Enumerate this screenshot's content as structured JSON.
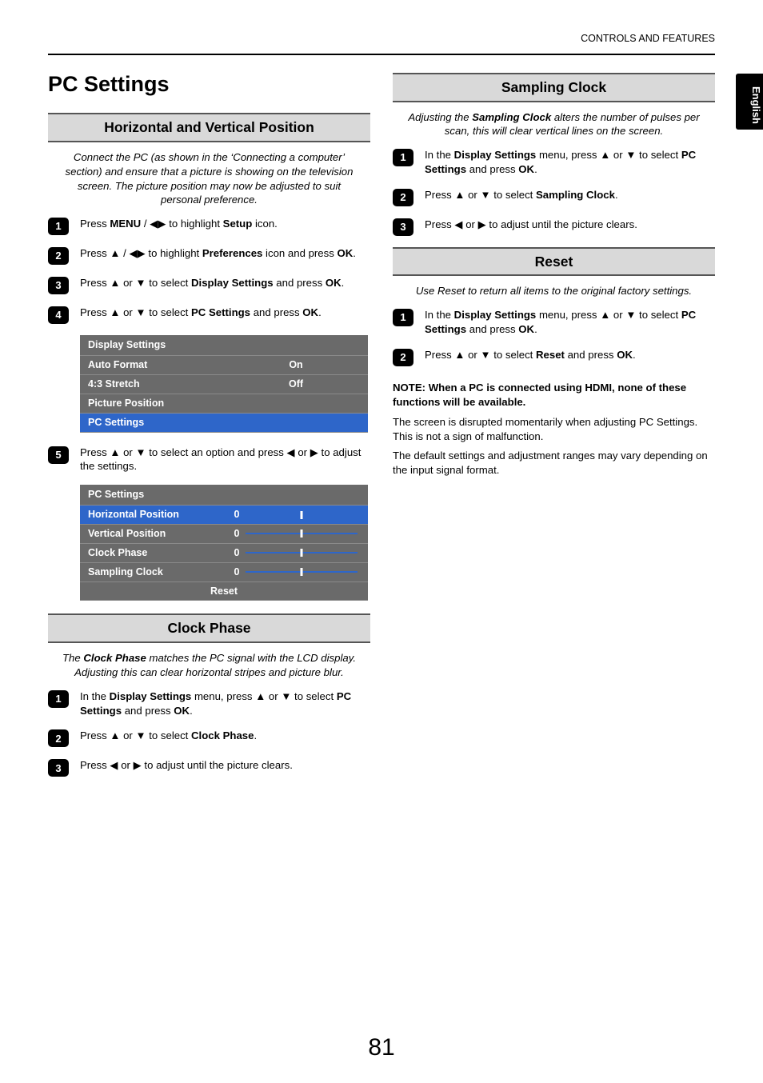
{
  "header": {
    "breadcrumb": "CONTROLS AND FEATURES",
    "lang_tab": "English"
  },
  "glyphs": {
    "up": "▲",
    "down": "▼",
    "left": "◀",
    "right": "▶"
  },
  "page_number": "81",
  "left": {
    "title": "PC Settings",
    "hv_band": "Horizontal and Vertical Position",
    "hv_intro": "Connect the PC (as shown in the ‘Connecting a computer’ section) and ensure that a picture is showing on the television screen. The picture position may now be adjusted to suit personal preference.",
    "step1_a": "Press ",
    "step1_menu": "MENU",
    "step1_b": " / ",
    "step1_c": " to highlight ",
    "step1_setup": "Setup",
    "step1_d": " icon.",
    "step2_a": "Press ",
    "step2_b": " / ",
    "step2_c": " to highlight ",
    "step2_prefs": "Preferences",
    "step2_d": " icon and press ",
    "step2_ok": "OK",
    "step2_e": ".",
    "step3_a": "Press ",
    "step3_b": " or ",
    "step3_c": " to select ",
    "step3_ds": "Display Settings",
    "step3_d": " and press ",
    "step3_ok": "OK",
    "step3_e": ".",
    "step4_a": "Press ",
    "step4_b": " or ",
    "step4_c": " to select ",
    "step4_pcs": "PC Settings",
    "step4_d": " and press ",
    "step4_ok": "OK",
    "step4_e": ".",
    "table1": {
      "title": "Display Settings",
      "rows": [
        {
          "label": "Auto Format",
          "value": "On"
        },
        {
          "label": "4:3 Stretch",
          "value": "Off"
        },
        {
          "label": "Picture Position",
          "value": ""
        },
        {
          "label": "PC Settings",
          "value": ""
        }
      ],
      "selected_index": 3
    },
    "step5_a": "Press ",
    "step5_b": " or ",
    "step5_c": " to select an option and press ",
    "step5_d": " or ",
    "step5_e": " to adjust the settings.",
    "table2": {
      "title": "PC Settings",
      "rows": [
        {
          "label": "Horizontal Position",
          "value": "0"
        },
        {
          "label": "Vertical Position",
          "value": "0"
        },
        {
          "label": "Clock Phase",
          "value": "0"
        },
        {
          "label": "Sampling Clock",
          "value": "0"
        }
      ],
      "selected_index": 0,
      "reset_label": "Reset"
    },
    "cp_band": "Clock Phase",
    "cp_intro_a": "The ",
    "cp_intro_bold": "Clock Phase",
    "cp_intro_b": " matches the PC signal with the LCD display. Adjusting this can clear horizontal stripes and picture blur.",
    "cp1_a": "In the ",
    "cp1_ds": "Display Settings",
    "cp1_b": " menu, press ",
    "cp1_c": " or ",
    "cp1_d": " to select ",
    "cp1_pcs": "PC Settings",
    "cp1_e": " and press ",
    "cp1_ok": "OK",
    "cp1_f": ".",
    "cp2_a": "Press ",
    "cp2_b": " or ",
    "cp2_c": " to select ",
    "cp2_cp": "Clock Phase",
    "cp2_d": ".",
    "cp3_a": "Press ",
    "cp3_b": " or ",
    "cp3_c": " to adjust until the picture clears."
  },
  "right": {
    "sc_band": "Sampling Clock",
    "sc_intro_a": "Adjusting the ",
    "sc_intro_bold": "Sampling Clock",
    "sc_intro_b": " alters the number of pulses per scan, this will clear vertical lines on the screen.",
    "sc1_a": "In the ",
    "sc1_ds": "Display Settings",
    "sc1_b": " menu, press ",
    "sc1_c": " or ",
    "sc1_d": " to select ",
    "sc1_pcs": "PC Settings",
    "sc1_e": " and press ",
    "sc1_ok": "OK",
    "sc1_f": ".",
    "sc2_a": "Press ",
    "sc2_b": " or ",
    "sc2_c": " to select ",
    "sc2_sc": "Sampling Clock",
    "sc2_d": ".",
    "sc3_a": "Press ",
    "sc3_b": " or ",
    "sc3_c": " to adjust until the picture clears.",
    "reset_band": "Reset",
    "reset_intro": "Use Reset to return all items to the original factory settings.",
    "r1_a": "In the ",
    "r1_ds": "Display Settings",
    "r1_b": " menu, press ",
    "r1_c": " or ",
    "r1_d": " to select ",
    "r1_pcs": "PC Settings",
    "r1_e": " and press ",
    "r1_ok": "OK",
    "r1_f": ".",
    "r2_a": "Press ",
    "r2_b": " or ",
    "r2_c": " to select ",
    "r2_reset": "Reset",
    "r2_d": " and press ",
    "r2_ok": "OK",
    "r2_e": ".",
    "note_heading": "NOTE: When a PC is connected using HDMI, none of these functions will be available.",
    "body1": "The screen is disrupted momentarily when adjusting PC Settings. This is not a sign of malfunction.",
    "body2": "The default settings and adjustment ranges may vary depending on the input signal format."
  }
}
